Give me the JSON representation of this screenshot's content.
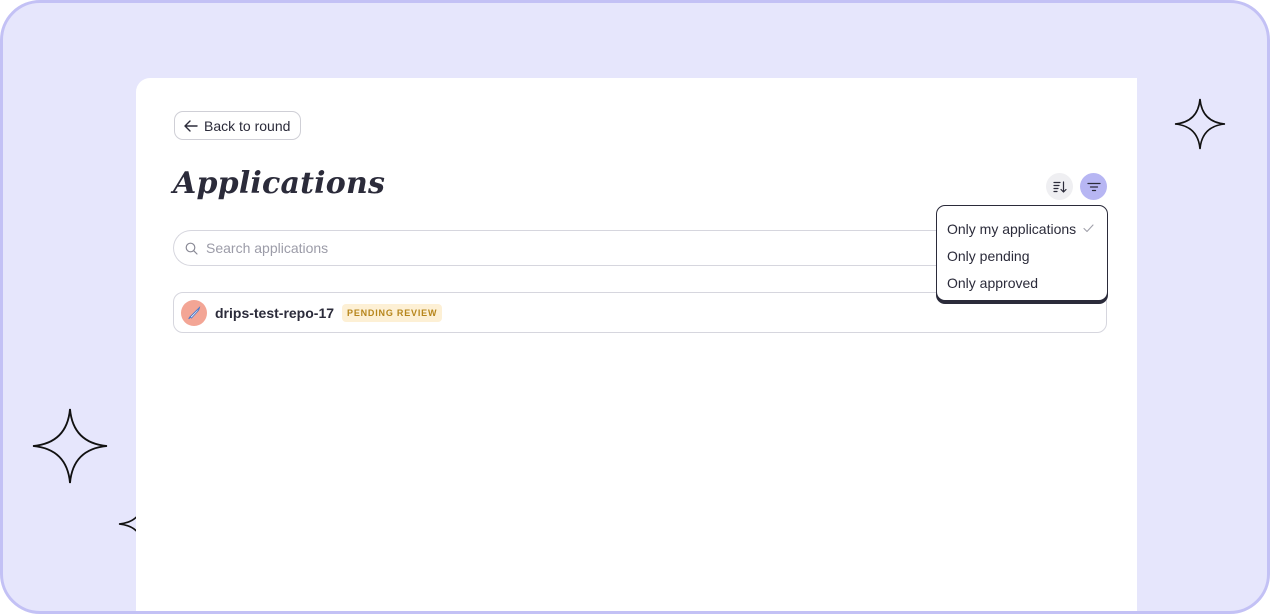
{
  "nav": {
    "back_label": "Back to round"
  },
  "page": {
    "title": "Applications"
  },
  "search": {
    "placeholder": "Search applications"
  },
  "applications": [
    {
      "name": "drips-test-repo-17",
      "status": "PENDING REVIEW"
    }
  ],
  "filter_menu": {
    "items": [
      {
        "label": "Only my applications",
        "checked": true
      },
      {
        "label": "Only pending",
        "checked": false
      },
      {
        "label": "Only approved",
        "checked": false
      }
    ]
  },
  "icons": {
    "back": "arrow-left-icon",
    "sort": "sort-icon",
    "filter": "filter-icon",
    "search": "search-icon",
    "check": "check-icon",
    "sparkle": "sparkle-icon"
  },
  "colors": {
    "background": "#e6e6fc",
    "frame_border": "#c3c1f5",
    "filter_button_active": "#b7b6f3",
    "badge_bg": "#fdf0d5",
    "badge_text": "#b7861c",
    "avatar": "#f3a595"
  }
}
